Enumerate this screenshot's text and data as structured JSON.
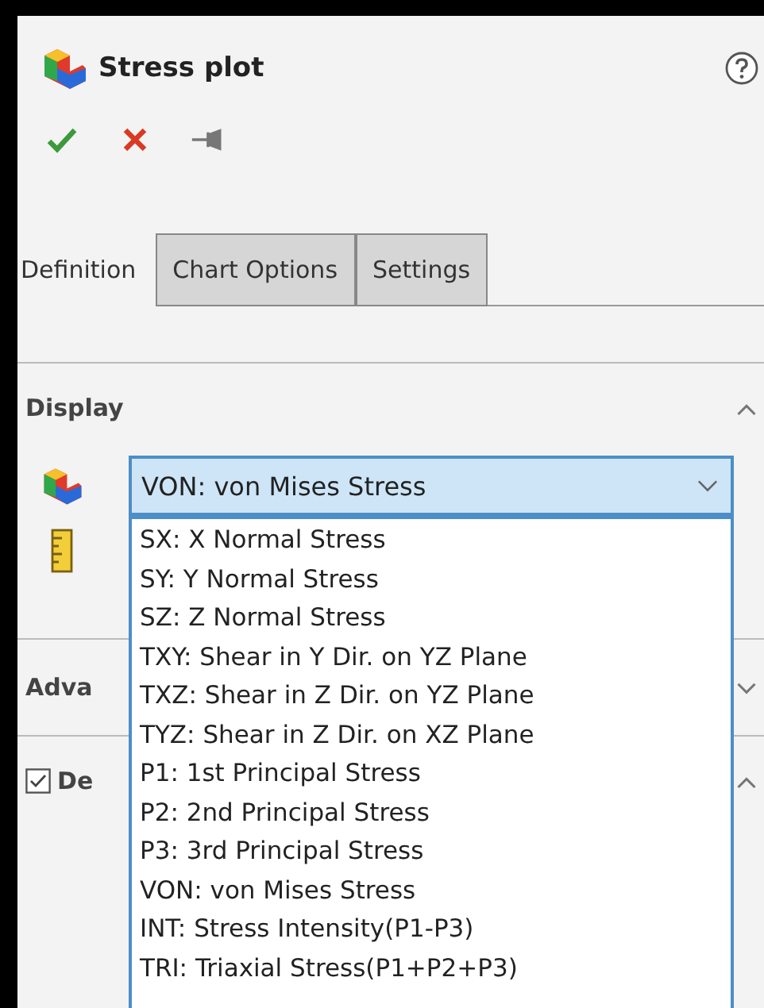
{
  "title": "Stress plot",
  "tabs": [
    {
      "label": "Definition",
      "selected": true
    },
    {
      "label": "Chart Options",
      "selected": false
    },
    {
      "label": "Settings",
      "selected": false
    }
  ],
  "display": {
    "heading": "Display",
    "expanded": true,
    "component": "VON: von Mises Stress",
    "dropdown_open": true,
    "options": [
      "SX: X Normal Stress",
      "SY: Y Normal Stress",
      "SZ: Z Normal Stress",
      "TXY: Shear in Y Dir. on YZ Plane",
      "TXZ: Shear in Z Dir. on YZ Plane",
      "TYZ: Shear in Z Dir. on XZ Plane",
      "P1: 1st Principal Stress",
      "P2: 2nd Principal Stress",
      "P3: 3rd Principal Stress",
      "VON: von Mises Stress",
      "INT: Stress Intensity(P1-P3)",
      "TRI: Triaxial Stress(P1+P2+P3)"
    ]
  },
  "advanced": {
    "heading": "Adva",
    "expanded": false
  },
  "deformed": {
    "label": "De",
    "checked": true,
    "expanded": true
  }
}
